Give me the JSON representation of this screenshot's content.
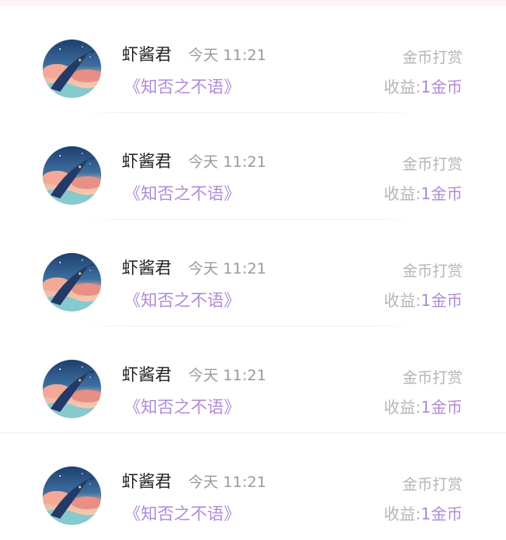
{
  "records": [
    {
      "user": "虾酱君",
      "time": "今天 11:21",
      "book": "《知否之不语》",
      "reward_type": "金币打赏",
      "income_label": "收益:",
      "income_value": "1金币"
    },
    {
      "user": "虾酱君",
      "time": "今天 11:21",
      "book": "《知否之不语》",
      "reward_type": "金币打赏",
      "income_label": "收益:",
      "income_value": "1金币"
    },
    {
      "user": "虾酱君",
      "time": "今天 11:21",
      "book": "《知否之不语》",
      "reward_type": "金币打赏",
      "income_label": "收益:",
      "income_value": "1金币"
    },
    {
      "user": "虾酱君",
      "time": "今天 11:21",
      "book": "《知否之不语》",
      "reward_type": "金币打赏",
      "income_label": "收益:",
      "income_value": "1金币"
    },
    {
      "user": "虾酱君",
      "time": "今天 11:21",
      "book": "《知否之不语》",
      "reward_type": "金币打赏",
      "income_label": "收益:",
      "income_value": "1金币"
    }
  ],
  "colors": {
    "accent": "#b08ad6",
    "muted": "#b5b5b5",
    "name": "#222222",
    "time": "#9a9a9a"
  },
  "icons": {
    "avatar": "whale-night-sky-avatar"
  }
}
